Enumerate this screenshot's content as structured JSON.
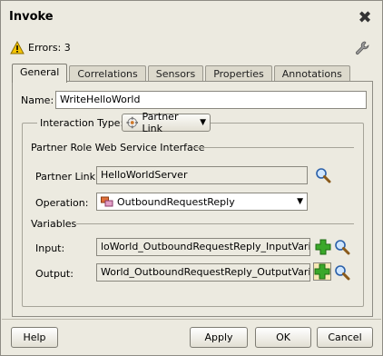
{
  "dialog": {
    "title": "Invoke"
  },
  "status": {
    "errors_text": "Errors: 3"
  },
  "tabs": [
    {
      "label": "General",
      "active": true
    },
    {
      "label": "Correlations",
      "active": false
    },
    {
      "label": "Sensors",
      "active": false
    },
    {
      "label": "Properties",
      "active": false
    },
    {
      "label": "Annotations",
      "active": false
    }
  ],
  "general": {
    "name_label": "Name:",
    "name_value": "WriteHelloWorld",
    "interaction_label": "Interaction Type:",
    "interaction_value": "Partner Link",
    "partner_role_heading": "Partner Role Web Service Interface",
    "partner_link_label": "Partner Link:",
    "partner_link_value": "HelloWorldServer",
    "operation_label": "Operation:",
    "operation_value": "OutboundRequestReply",
    "variables_heading": "Variables",
    "input_label": "Input:",
    "input_value": "loWorld_OutboundRequestReply_InputVariable",
    "output_label": "Output:",
    "output_value": "World_OutboundRequestReply_OutputVariable"
  },
  "buttons": {
    "help": "Help",
    "apply": "Apply",
    "ok": "OK",
    "cancel": "Cancel"
  },
  "icons": {
    "close": "close-icon",
    "warning": "warning-icon",
    "wrench": "wrench-icon",
    "search": "search-icon",
    "add": "add-icon"
  }
}
